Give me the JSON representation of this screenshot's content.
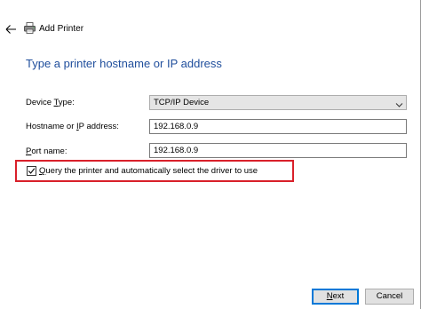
{
  "window": {
    "title": "Add Printer"
  },
  "heading": "Type a printer hostname or IP address",
  "form": {
    "device_type": {
      "label_mnemonic": "T",
      "label_rest": "Device ",
      "label_after": "ype:",
      "value": "TCP/IP Device"
    },
    "hostname": {
      "label_before": "Hostname or ",
      "label_mnemonic": "I",
      "label_after": "P address:",
      "value": "192.168.0.9"
    },
    "port": {
      "label_mnemonic": "P",
      "label_after": "ort name:",
      "value": "192.168.0.9"
    },
    "query_checkbox": {
      "label_mnemonic": "Q",
      "label_after": "uery the printer and automatically select the driver to use",
      "checked": true
    }
  },
  "buttons": {
    "next_mnemonic": "N",
    "next_after": "ext",
    "cancel": "Cancel"
  },
  "colors": {
    "heading": "#1f4e9c",
    "highlight_box": "#d9202a",
    "default_button_border": "#0078d7"
  },
  "icons": {
    "back": "back-arrow-icon",
    "title": "printer-icon",
    "dropdown": "chevron-down-icon",
    "check": "checkmark-icon"
  }
}
